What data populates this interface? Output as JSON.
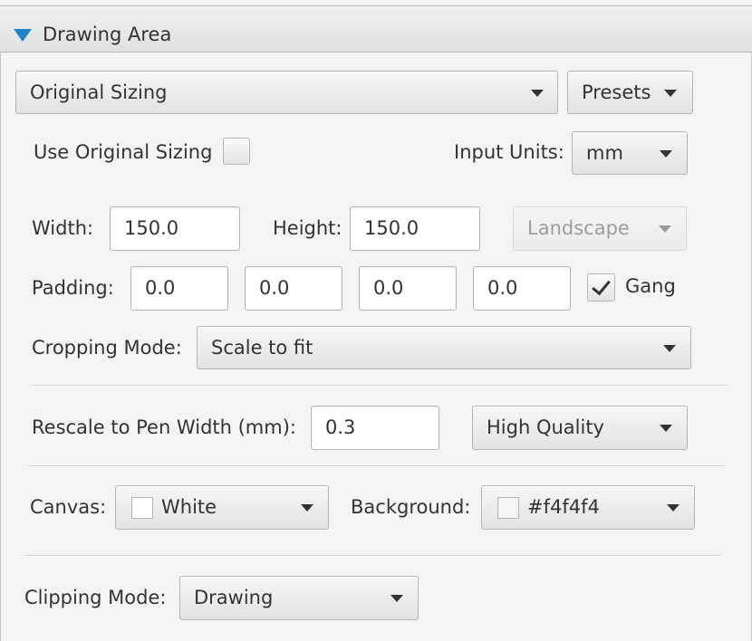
{
  "section": {
    "title": "Drawing Area"
  },
  "sizing": {
    "preset_value": "Original Sizing",
    "presets_label": "Presets",
    "use_original_label": "Use Original Sizing",
    "use_original_checked": false,
    "input_units_label": "Input Units:",
    "input_units_value": "mm"
  },
  "dimensions": {
    "width_label": "Width:",
    "width_value": "150.0",
    "height_label": "Height:",
    "height_value": "150.0",
    "orientation_value": "Landscape"
  },
  "padding": {
    "label": "Padding:",
    "values": [
      "0.0",
      "0.0",
      "0.0",
      "0.0"
    ],
    "gang_label": "Gang",
    "gang_checked": true
  },
  "cropping": {
    "label": "Cropping Mode:",
    "value": "Scale to fit"
  },
  "rescale": {
    "label": "Rescale to Pen Width (mm):",
    "value": "0.3",
    "quality_value": "High Quality"
  },
  "colors": {
    "canvas_label": "Canvas:",
    "canvas_value": "White",
    "canvas_color": "#ffffff",
    "background_label": "Background:",
    "background_value": "#f4f4f4",
    "background_color": "#f4f4f4",
    "accent": "#1c86c8"
  },
  "clipping": {
    "label": "Clipping Mode:",
    "value": "Drawing"
  }
}
